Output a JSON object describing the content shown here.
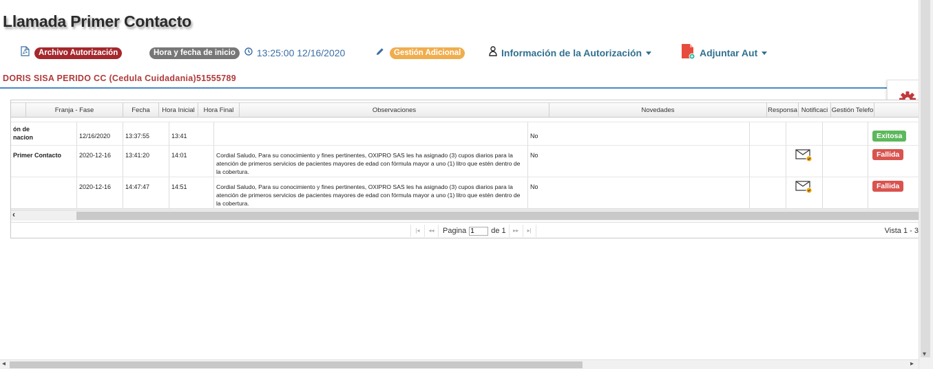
{
  "page": {
    "title": "Llamada Primer Contacto"
  },
  "toolbar": {
    "archivo_label": "Archivo Autorización",
    "hora_label": "Hora y fecha de inicio",
    "hora_value": "13:25:00 12/16/2020",
    "gestion_label": "Gestión Adicional",
    "info_label": "Información de la Autorización",
    "adjuntar_label": "Adjuntar Aut"
  },
  "patient": {
    "name": "DORIS SISA PERIDO CC (Cedula Cuidadania)51555789"
  },
  "grid": {
    "columns": [
      "",
      "Franja - Fase",
      "Fecha",
      "Hora Inicial",
      "Hora Final",
      "Observaciones",
      "Novedades",
      "Responsa",
      "Notificaci",
      "Gestión Telefo",
      ""
    ],
    "rows": [
      {
        "fase": "ón de\nnacion",
        "fecha": "12/16/2020",
        "hora_ini": "13:37:55",
        "hora_fin": "13:41",
        "obs": "",
        "novedad": "No",
        "status": "Exitosa",
        "notif": false
      },
      {
        "fase": "Primer Contacto",
        "fecha": "2020-12-16",
        "hora_ini": "13:41:20",
        "hora_fin": "14:01",
        "obs": "Cordial Saludo, Para su conocimiento y fines pertinentes, OXIPRO SAS les ha asignado (3) cupos diarios para la atención de primeros servicios de pacientes mayores de edad con fórmula mayor a uno (1) litro que estén dentro de la cobertura.",
        "novedad": "No",
        "status": "Fallida",
        "notif": true
      },
      {
        "fase": "",
        "fecha": "2020-12-16",
        "hora_ini": "14:47:47",
        "hora_fin": "14:51",
        "obs": "Cordial Saludo, Para su conocimiento y fines pertinentes, OXIPRO SAS les ha asignado (3) cupos diarios para la atención de primeros servicios de pacientes mayores de edad con fórmula mayor a uno (1) litro que estén dentro de la cobertura.",
        "novedad": "No",
        "status": "Fallida",
        "notif": true
      }
    ],
    "pager": {
      "page_label": "Pagina",
      "page_value": "1",
      "of_label": "de 1",
      "view_label": "Vista 1 - 3"
    }
  },
  "colors": {
    "accent": "#4a86c8",
    "danger": "#d9534f",
    "success": "#5cb85c",
    "brand_red": "#a4282d",
    "warning": "#f0ad4e"
  }
}
